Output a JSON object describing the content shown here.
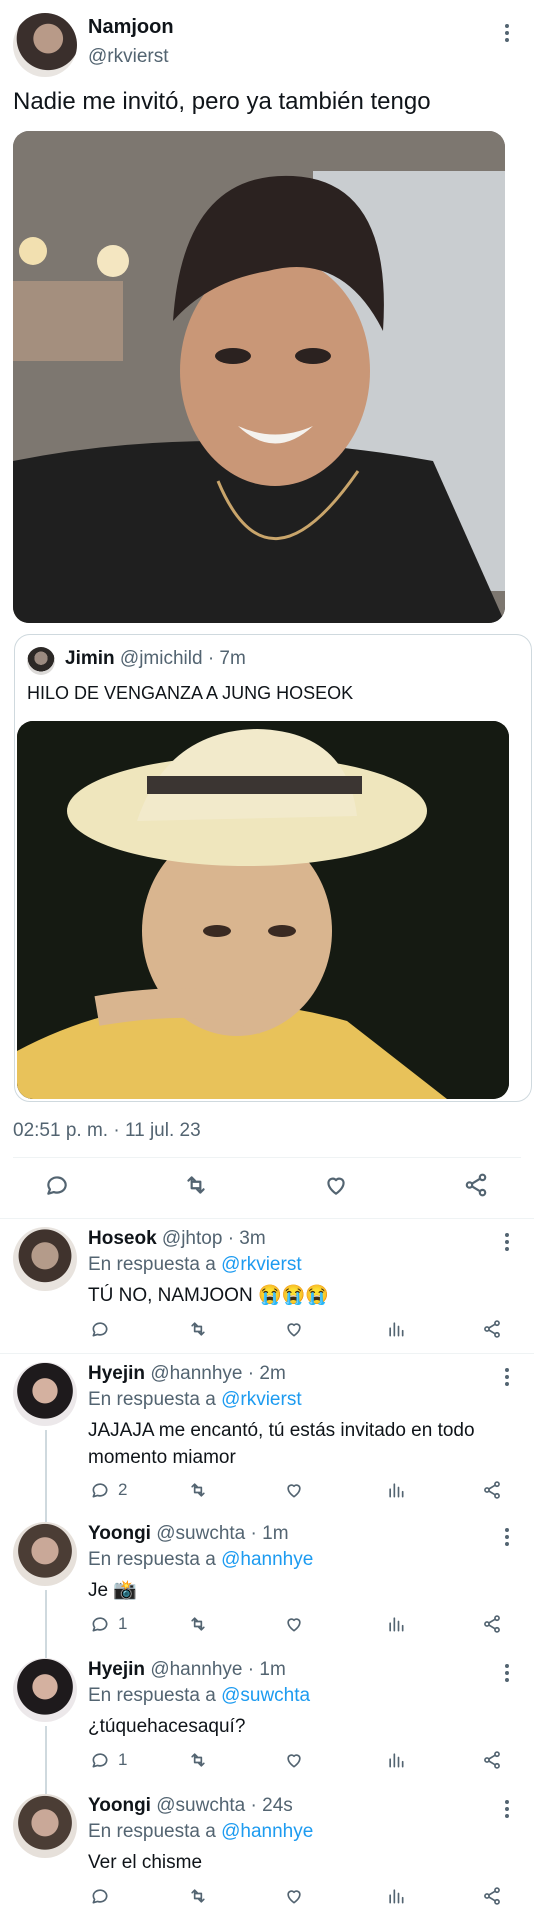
{
  "main_tweet": {
    "name": "Namjoon",
    "handle": "@rkvierst",
    "text": "Nadie me invitó, pero ya también tengo",
    "timestamp": "02:51 p. m. · 11 jul. 23"
  },
  "quoted_tweet": {
    "name": "Jimin",
    "handle": "@jmichild",
    "time": "· 7m",
    "text": "HILO DE VENGANZA A JUNG HOSEOK"
  },
  "replies": [
    {
      "name": "Hoseok",
      "handle": "@jhtop",
      "time": "· 3m",
      "reply_prefix": "En respuesta a",
      "reply_to": "@rkvierst",
      "text": "TÚ NO, NAMJOON 😭😭😭",
      "reply_count": ""
    },
    {
      "name": "Hyejin",
      "handle": "@hannhye",
      "time": "· 2m",
      "reply_prefix": "En respuesta a",
      "reply_to": "@rkvierst",
      "text": "JAJAJA me encantó, tú estás invitado en todo momento miamor",
      "reply_count": "2"
    },
    {
      "name": "Yoongi",
      "handle": "@suwchta",
      "time": "· 1m",
      "reply_prefix": "En respuesta a",
      "reply_to": "@hannhye",
      "text": "Je 📸",
      "reply_count": "1"
    },
    {
      "name": "Hyejin",
      "handle": "@hannhye",
      "time": "· 1m",
      "reply_prefix": "En respuesta a",
      "reply_to": "@suwchta",
      "text": "¿túquehacesaquí?",
      "reply_count": "1"
    },
    {
      "name": "Yoongi",
      "handle": "@suwchta",
      "time": "· 24s",
      "reply_prefix": "En respuesta a",
      "reply_to": "@hannhye",
      "text": "Ver el chisme",
      "reply_count": ""
    }
  ],
  "icons": {
    "reply": "speech-bubble-icon",
    "retweet": "retweet-icon",
    "like": "heart-icon",
    "views": "bar-chart-icon",
    "share": "share-icon"
  },
  "colors": {
    "link": "#1d9bf0",
    "muted": "#536471",
    "text": "#0f1419",
    "border": "#cfd9de"
  }
}
